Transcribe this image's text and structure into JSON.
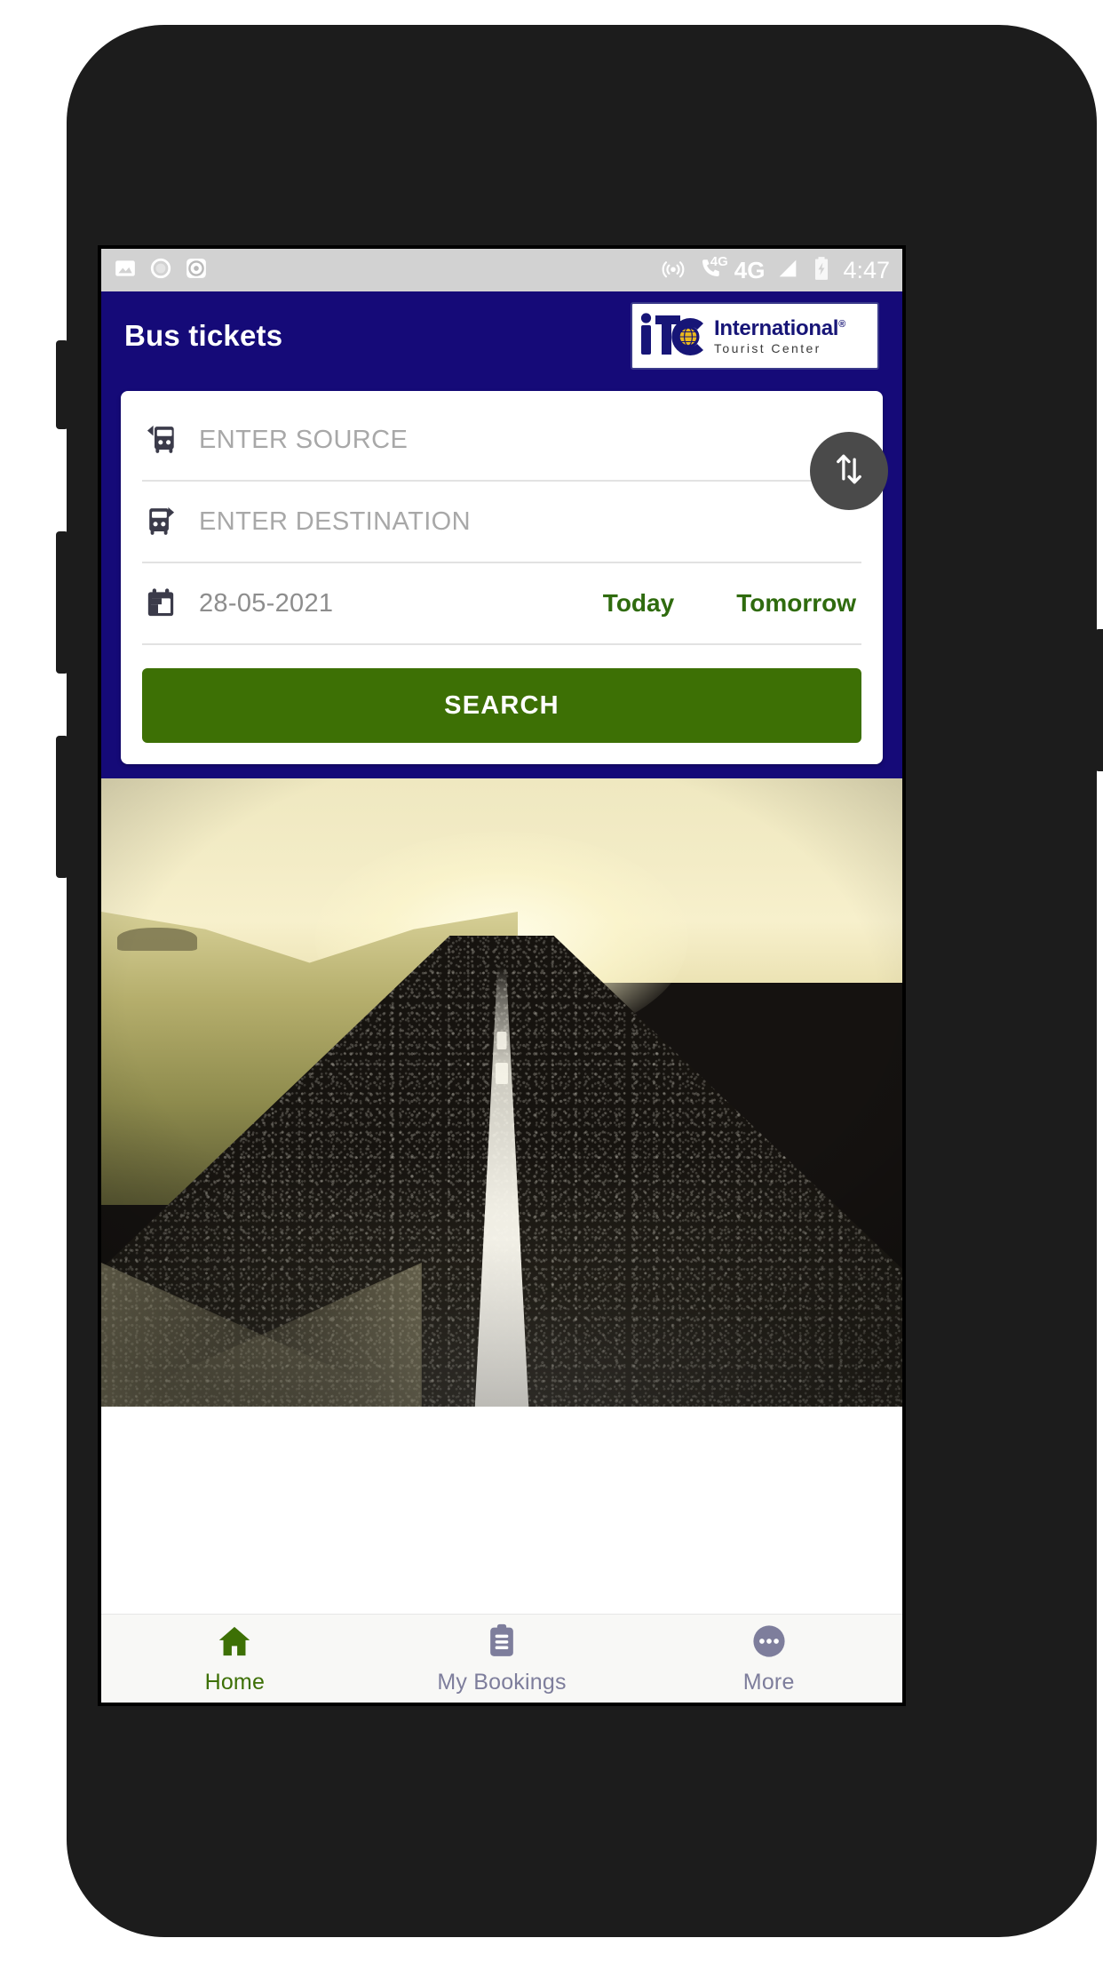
{
  "status_bar": {
    "left_icons": [
      "image-icon",
      "circle-icon",
      "record-icon"
    ],
    "right_icons": [
      "hotspot-icon",
      "call-4g-icon",
      "network-4g-icon",
      "signal-bars-icon",
      "battery-charging-icon"
    ],
    "network_label": "4G",
    "call_network_label": "4G",
    "clock": "4:47"
  },
  "app_bar": {
    "title": "Bus tickets",
    "logo": {
      "mark": "iTC",
      "line1": "International",
      "registered": "®",
      "line2": "Tourist Center"
    }
  },
  "search_card": {
    "source": {
      "icon": "bus-arrive-icon",
      "value": "",
      "placeholder": "ENTER SOURCE"
    },
    "destination": {
      "icon": "bus-depart-icon",
      "value": "",
      "placeholder": "ENTER DESTINATION"
    },
    "swap": {
      "icon": "swap-vertical-icon"
    },
    "date": {
      "icon": "calendar-icon",
      "value": "28-05-2021",
      "today_label": "Today",
      "tomorrow_label": "Tomorrow"
    },
    "search_button_label": "SEARCH"
  },
  "hero": {
    "alt": "open road through golden fields at sunrise"
  },
  "bottom_nav": {
    "items": [
      {
        "label": "Home",
        "icon": "home-icon",
        "active": true
      },
      {
        "label": "My Bookings",
        "icon": "clipboard-icon",
        "active": false
      },
      {
        "label": "More",
        "icon": "more-dots-icon",
        "active": false
      }
    ]
  },
  "colors": {
    "app_bar_blue": "#150a78",
    "accent_green": "#3d7005",
    "quick_date_green": "#2f6b0e",
    "nav_inactive": "#7e7e9c",
    "status_bar_gray": "#d2d2d2",
    "swap_gray": "#4a4a4a",
    "placeholder_gray": "#a8a8a8"
  }
}
